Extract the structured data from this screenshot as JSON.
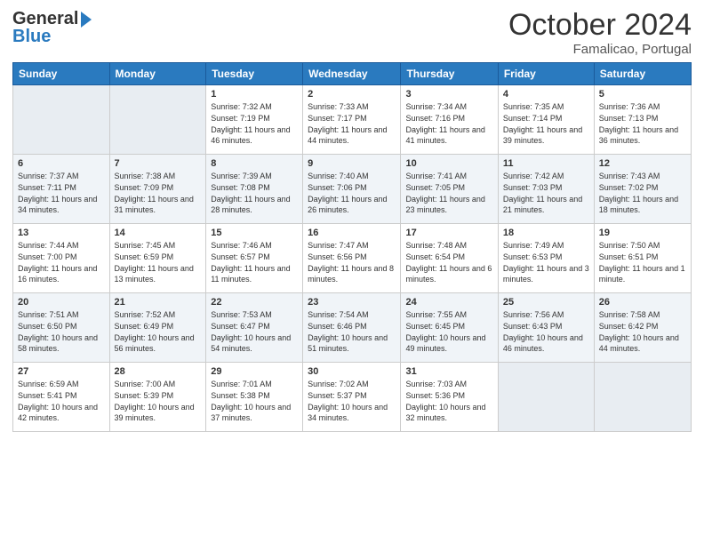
{
  "header": {
    "logo_line1": "General",
    "logo_line2": "Blue",
    "month": "October 2024",
    "location": "Famalicao, Portugal"
  },
  "columns": [
    "Sunday",
    "Monday",
    "Tuesday",
    "Wednesday",
    "Thursday",
    "Friday",
    "Saturday"
  ],
  "weeks": [
    [
      {
        "day": "",
        "info": ""
      },
      {
        "day": "",
        "info": ""
      },
      {
        "day": "1",
        "info": "Sunrise: 7:32 AM\nSunset: 7:19 PM\nDaylight: 11 hours and 46 minutes."
      },
      {
        "day": "2",
        "info": "Sunrise: 7:33 AM\nSunset: 7:17 PM\nDaylight: 11 hours and 44 minutes."
      },
      {
        "day": "3",
        "info": "Sunrise: 7:34 AM\nSunset: 7:16 PM\nDaylight: 11 hours and 41 minutes."
      },
      {
        "day": "4",
        "info": "Sunrise: 7:35 AM\nSunset: 7:14 PM\nDaylight: 11 hours and 39 minutes."
      },
      {
        "day": "5",
        "info": "Sunrise: 7:36 AM\nSunset: 7:13 PM\nDaylight: 11 hours and 36 minutes."
      }
    ],
    [
      {
        "day": "6",
        "info": "Sunrise: 7:37 AM\nSunset: 7:11 PM\nDaylight: 11 hours and 34 minutes."
      },
      {
        "day": "7",
        "info": "Sunrise: 7:38 AM\nSunset: 7:09 PM\nDaylight: 11 hours and 31 minutes."
      },
      {
        "day": "8",
        "info": "Sunrise: 7:39 AM\nSunset: 7:08 PM\nDaylight: 11 hours and 28 minutes."
      },
      {
        "day": "9",
        "info": "Sunrise: 7:40 AM\nSunset: 7:06 PM\nDaylight: 11 hours and 26 minutes."
      },
      {
        "day": "10",
        "info": "Sunrise: 7:41 AM\nSunset: 7:05 PM\nDaylight: 11 hours and 23 minutes."
      },
      {
        "day": "11",
        "info": "Sunrise: 7:42 AM\nSunset: 7:03 PM\nDaylight: 11 hours and 21 minutes."
      },
      {
        "day": "12",
        "info": "Sunrise: 7:43 AM\nSunset: 7:02 PM\nDaylight: 11 hours and 18 minutes."
      }
    ],
    [
      {
        "day": "13",
        "info": "Sunrise: 7:44 AM\nSunset: 7:00 PM\nDaylight: 11 hours and 16 minutes."
      },
      {
        "day": "14",
        "info": "Sunrise: 7:45 AM\nSunset: 6:59 PM\nDaylight: 11 hours and 13 minutes."
      },
      {
        "day": "15",
        "info": "Sunrise: 7:46 AM\nSunset: 6:57 PM\nDaylight: 11 hours and 11 minutes."
      },
      {
        "day": "16",
        "info": "Sunrise: 7:47 AM\nSunset: 6:56 PM\nDaylight: 11 hours and 8 minutes."
      },
      {
        "day": "17",
        "info": "Sunrise: 7:48 AM\nSunset: 6:54 PM\nDaylight: 11 hours and 6 minutes."
      },
      {
        "day": "18",
        "info": "Sunrise: 7:49 AM\nSunset: 6:53 PM\nDaylight: 11 hours and 3 minutes."
      },
      {
        "day": "19",
        "info": "Sunrise: 7:50 AM\nSunset: 6:51 PM\nDaylight: 11 hours and 1 minute."
      }
    ],
    [
      {
        "day": "20",
        "info": "Sunrise: 7:51 AM\nSunset: 6:50 PM\nDaylight: 10 hours and 58 minutes."
      },
      {
        "day": "21",
        "info": "Sunrise: 7:52 AM\nSunset: 6:49 PM\nDaylight: 10 hours and 56 minutes."
      },
      {
        "day": "22",
        "info": "Sunrise: 7:53 AM\nSunset: 6:47 PM\nDaylight: 10 hours and 54 minutes."
      },
      {
        "day": "23",
        "info": "Sunrise: 7:54 AM\nSunset: 6:46 PM\nDaylight: 10 hours and 51 minutes."
      },
      {
        "day": "24",
        "info": "Sunrise: 7:55 AM\nSunset: 6:45 PM\nDaylight: 10 hours and 49 minutes."
      },
      {
        "day": "25",
        "info": "Sunrise: 7:56 AM\nSunset: 6:43 PM\nDaylight: 10 hours and 46 minutes."
      },
      {
        "day": "26",
        "info": "Sunrise: 7:58 AM\nSunset: 6:42 PM\nDaylight: 10 hours and 44 minutes."
      }
    ],
    [
      {
        "day": "27",
        "info": "Sunrise: 6:59 AM\nSunset: 5:41 PM\nDaylight: 10 hours and 42 minutes."
      },
      {
        "day": "28",
        "info": "Sunrise: 7:00 AM\nSunset: 5:39 PM\nDaylight: 10 hours and 39 minutes."
      },
      {
        "day": "29",
        "info": "Sunrise: 7:01 AM\nSunset: 5:38 PM\nDaylight: 10 hours and 37 minutes."
      },
      {
        "day": "30",
        "info": "Sunrise: 7:02 AM\nSunset: 5:37 PM\nDaylight: 10 hours and 34 minutes."
      },
      {
        "day": "31",
        "info": "Sunrise: 7:03 AM\nSunset: 5:36 PM\nDaylight: 10 hours and 32 minutes."
      },
      {
        "day": "",
        "info": ""
      },
      {
        "day": "",
        "info": ""
      }
    ]
  ]
}
